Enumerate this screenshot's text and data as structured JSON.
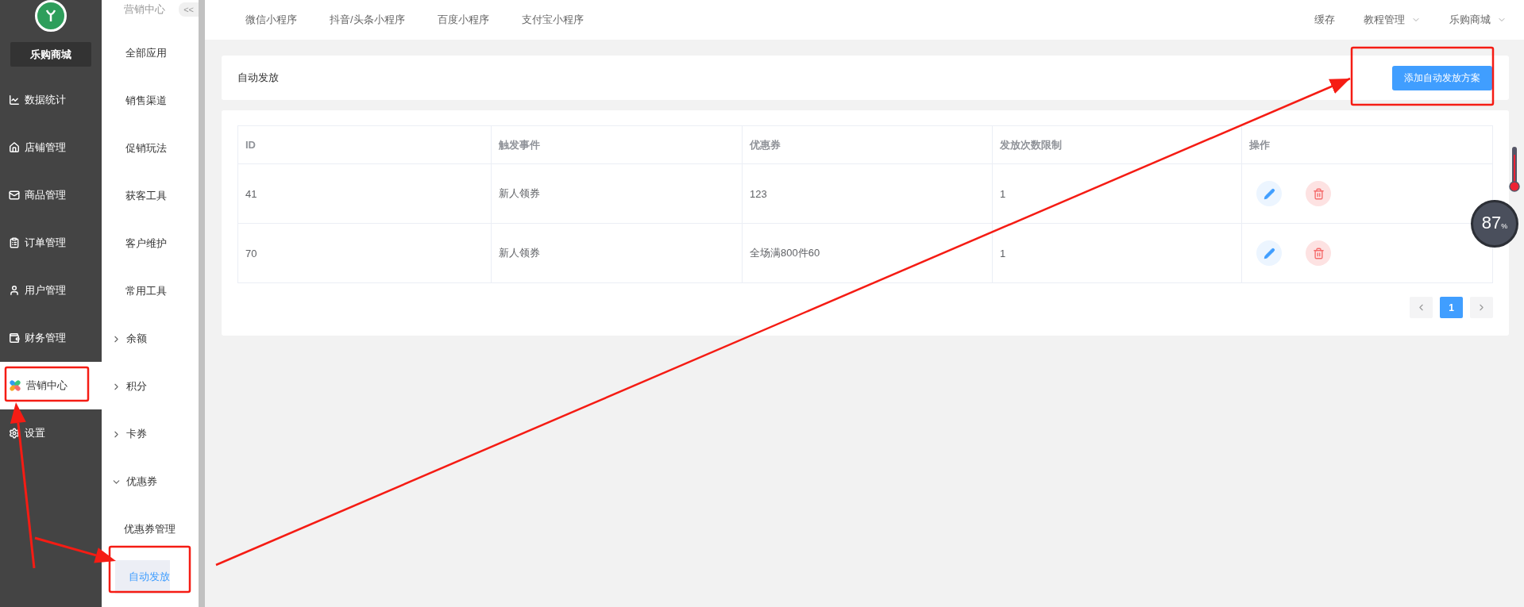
{
  "sidebar": {
    "store_name": "乐购商城",
    "items": [
      {
        "label": "数据统计",
        "selected": false
      },
      {
        "label": "店铺管理",
        "selected": false
      },
      {
        "label": "商品管理",
        "selected": false
      },
      {
        "label": "订单管理",
        "selected": false
      },
      {
        "label": "用户管理",
        "selected": false
      },
      {
        "label": "财务管理",
        "selected": false
      },
      {
        "label": "营销中心",
        "selected": true
      },
      {
        "label": "设置",
        "selected": false
      }
    ]
  },
  "submenu": {
    "title": "营销中心",
    "collapse_label": "<<",
    "items": [
      {
        "kind": "link",
        "label": "全部应用"
      },
      {
        "kind": "link",
        "label": "销售渠道"
      },
      {
        "kind": "link",
        "label": "促销玩法"
      },
      {
        "kind": "link",
        "label": "获客工具"
      },
      {
        "kind": "link",
        "label": "客户维护"
      },
      {
        "kind": "link",
        "label": "常用工具"
      },
      {
        "kind": "group",
        "label": "余额",
        "expanded": false
      },
      {
        "kind": "group",
        "label": "积分",
        "expanded": false
      },
      {
        "kind": "group",
        "label": "卡券",
        "expanded": false
      },
      {
        "kind": "group",
        "label": "优惠券",
        "expanded": true,
        "children": [
          {
            "label": "优惠券管理",
            "selected": false
          },
          {
            "label": "自动发放",
            "selected": true
          }
        ]
      }
    ]
  },
  "top_tabs": [
    "微信小程序",
    "抖音/头条小程序",
    "百度小程序",
    "支付宝小程序"
  ],
  "top_right": [
    {
      "label": "缓存",
      "dropdown": false
    },
    {
      "label": "教程管理",
      "dropdown": true
    },
    {
      "label": "乐购商城",
      "dropdown": true
    }
  ],
  "page_title": "自动发放",
  "add_button": "添加自动发放方案",
  "table": {
    "columns": [
      "ID",
      "触发事件",
      "优惠券",
      "发放次数限制",
      "操作"
    ],
    "rows": [
      {
        "id": "41",
        "event": "新人领券",
        "coupon": "123",
        "limit": "1"
      },
      {
        "id": "70",
        "event": "新人领券",
        "coupon": "全场满800件60",
        "limit": "1"
      }
    ]
  },
  "pagination": {
    "pages": [
      {
        "label": "1",
        "selected": true
      }
    ]
  },
  "gauge": {
    "value": "87",
    "unit": "%"
  }
}
